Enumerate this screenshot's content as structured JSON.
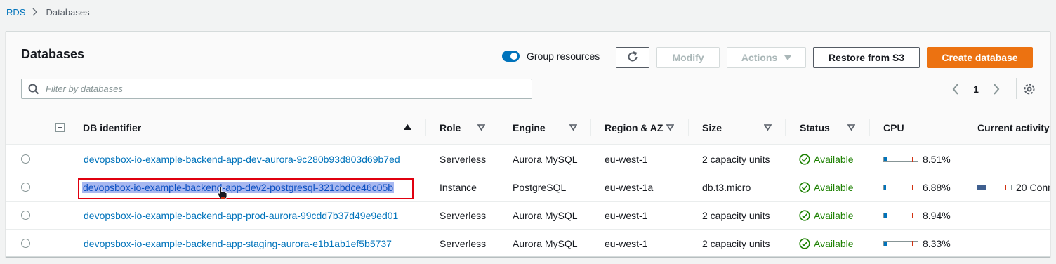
{
  "breadcrumb": {
    "root": "RDS",
    "current": "Databases"
  },
  "panel": {
    "title": "Databases",
    "group_label": "Group resources",
    "refresh_icon": "refresh-icon",
    "modify_label": "Modify",
    "actions_label": "Actions",
    "restore_label": "Restore from S3",
    "create_label": "Create database",
    "filter_placeholder": "Filter by databases",
    "page_number": "1"
  },
  "columns": {
    "db_identifier": "DB identifier",
    "role": "Role",
    "engine": "Engine",
    "region": "Region & AZ",
    "size": "Size",
    "status": "Status",
    "cpu": "CPU",
    "activity": "Current activity"
  },
  "rows": [
    {
      "id": "devopsbox-io-example-backend-app-dev-aurora-9c280b93d803d69b7ed",
      "role": "Serverless",
      "engine": "Aurora MySQL",
      "region": "eu-west-1",
      "size": "2 capacity units",
      "status": "Available",
      "cpu": "8.51%",
      "cpu_fraction": 0.0851,
      "activity": ""
    },
    {
      "id": "devopsbox-io-example-backend-app-dev2-postgresql-321cbdce46c05b",
      "role": "Instance",
      "engine": "PostgreSQL",
      "region": "eu-west-1a",
      "size": "db.t3.micro",
      "status": "Available",
      "cpu": "6.88%",
      "cpu_fraction": 0.0688,
      "activity": "20 Conn"
    },
    {
      "id": "devopsbox-io-example-backend-app-prod-aurora-99cdd7b37d49e9ed01",
      "role": "Serverless",
      "engine": "Aurora MySQL",
      "region": "eu-west-1",
      "size": "2 capacity units",
      "status": "Available",
      "cpu": "8.94%",
      "cpu_fraction": 0.0894,
      "activity": ""
    },
    {
      "id": "devopsbox-io-example-backend-app-staging-aurora-e1b1ab1ef5b5737",
      "role": "Serverless",
      "engine": "Aurora MySQL",
      "region": "eu-west-1",
      "size": "2 capacity units",
      "status": "Available",
      "cpu": "8.33%",
      "cpu_fraction": 0.0833,
      "activity": ""
    }
  ],
  "colors": {
    "accent": "#0073bb",
    "primary": "#ec7211",
    "success": "#1d8102",
    "highlight": "#e0000f"
  }
}
